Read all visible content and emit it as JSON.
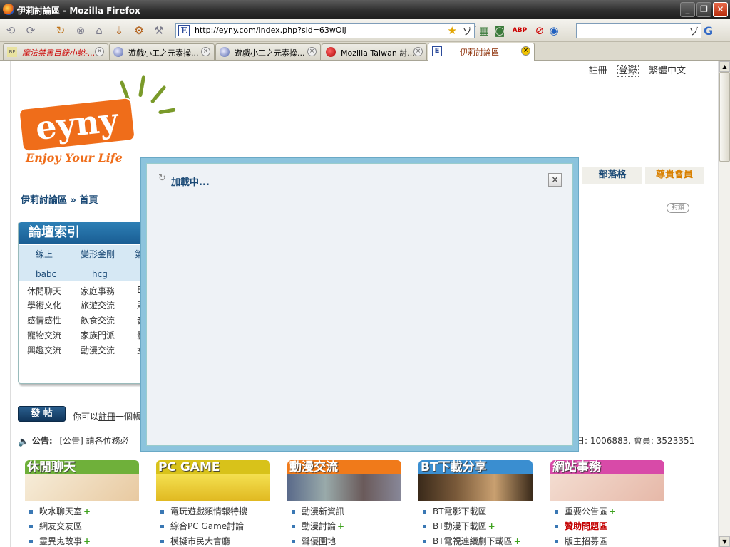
{
  "window": {
    "title": "伊莉討論區 - Mozilla Firefox"
  },
  "toolbar": {
    "url": "http://eyny.com/index.php?sid=63wOlj",
    "favicon_letter": "E",
    "search_placeholder": ""
  },
  "tabs": [
    {
      "label": "魔法禁書目錄小說-..."
    },
    {
      "label": "遊戲小工之元素操..."
    },
    {
      "label": "遊戲小工之元素操..."
    },
    {
      "label": "Mozilla Taiwan 討..."
    },
    {
      "label": "伊莉討論區"
    }
  ],
  "header": {
    "links": [
      "註冊",
      "登錄",
      "繁體中文"
    ],
    "logo_text": "eyny",
    "logo_tagline": "Enjoy Your Life",
    "nav_right": [
      "部落格",
      "尊貴會員"
    ],
    "stamp": "封鎖"
  },
  "breadcrumb": "伊莉討論區 » 首頁",
  "forum_index": {
    "title": "論壇索引",
    "top_links": [
      "線上",
      "變形金剛",
      "第"
    ],
    "top_links2": [
      "babc",
      "hcg"
    ],
    "rows": [
      [
        "休閒聊天",
        "家庭事務",
        "E"
      ],
      [
        "學術文化",
        "旅遊交流",
        "貼"
      ],
      [
        "感情感性",
        "飲食交流",
        "音"
      ],
      [
        "寵物交流",
        "家族門派",
        "影"
      ],
      [
        "興趣交流",
        "動漫交流",
        "女"
      ]
    ]
  },
  "post": {
    "button": "發 帖",
    "info_prefix": "你可以",
    "info_link": "註冊",
    "info_suffix": "一個帳"
  },
  "announce": {
    "label": "公告:",
    "text": "[公告] 請各位務必"
  },
  "stats": {
    "text": "日: 1006883, 會員: 3523351"
  },
  "categories": [
    {
      "title": "休閒聊天",
      "color": "#6fb03a",
      "items": [
        {
          "t": "吹水聊天室",
          "plus": true
        },
        {
          "t": "網友交友區",
          "plus": false
        },
        {
          "t": "靈異鬼故事",
          "plus": true
        }
      ]
    },
    {
      "title": "PC GAME",
      "color": "#d8c21a",
      "items": [
        {
          "t": "電玩遊戲類情報特搜",
          "plus": false
        },
        {
          "t": "綜合PC Game討論",
          "plus": false
        },
        {
          "t": "模擬市民大會廳",
          "plus": false
        }
      ]
    },
    {
      "title": "動漫交流",
      "color": "#f07a1a",
      "items": [
        {
          "t": "動漫新資訊",
          "plus": false
        },
        {
          "t": "動漫討論",
          "plus": true
        },
        {
          "t": "聲優園地",
          "plus": false
        }
      ]
    },
    {
      "title": "BT下載分享",
      "color": "#3a8ed0",
      "items": [
        {
          "t": "BT電影下載區",
          "plus": false
        },
        {
          "t": "BT動漫下載區",
          "plus": true
        },
        {
          "t": "BT電視連續劇下載區",
          "plus": true
        }
      ]
    },
    {
      "title": "網站事務",
      "color": "#d84aa8",
      "items": [
        {
          "t": "重要公告區",
          "plus": true
        },
        {
          "t": "贊助問題區",
          "plus": false,
          "red": true
        },
        {
          "t": "版主招募區",
          "plus": false
        }
      ]
    }
  ],
  "modal": {
    "loading": "加載中...",
    "close": "×"
  },
  "colors": {
    "modal_border": "#8cc4dd",
    "brand_orange": "#ef6d1a",
    "link_blue": "#1b4a76"
  }
}
